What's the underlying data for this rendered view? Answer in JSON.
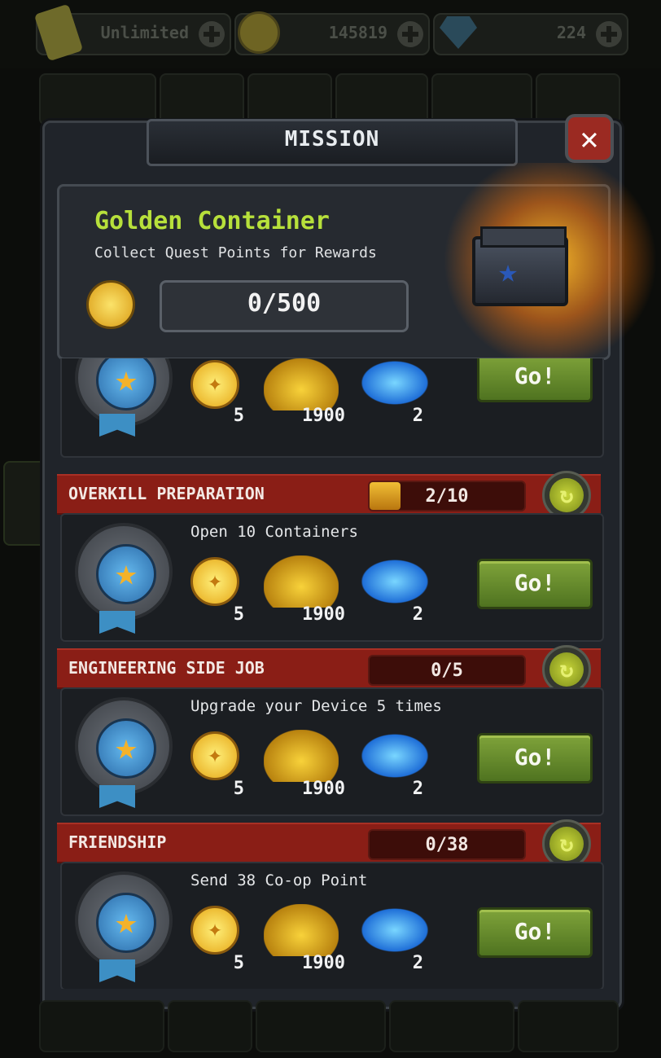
{
  "currencies": {
    "energy": {
      "value": "Unlimited",
      "icon": "dog-tag-icon"
    },
    "coins": {
      "value": "145819",
      "icon": "coin-icon"
    },
    "gems": {
      "value": "224",
      "icon": "gem-icon"
    }
  },
  "dialog": {
    "title": "MISSION",
    "close_icon": "close-icon"
  },
  "golden_container": {
    "name": "Golden Container",
    "subtitle": "Collect Quest Points for Rewards",
    "progress": "0/500",
    "progress_current": 0,
    "progress_max": 500
  },
  "missions": [
    {
      "name": "",
      "description": "",
      "progress": "",
      "progress_fraction": 0,
      "rewards": {
        "quest_points": "5",
        "coins": "1900",
        "gems": "2"
      },
      "go_label": "Go!"
    },
    {
      "name": "OVERKILL PREPARATION",
      "description": "Open 10 Containers",
      "progress": "2/10",
      "progress_fraction": 0.2,
      "rewards": {
        "quest_points": "5",
        "coins": "1900",
        "gems": "2"
      },
      "go_label": "Go!"
    },
    {
      "name": "ENGINEERING SIDE JOB",
      "description": "Upgrade your Device 5 times",
      "progress": "0/5",
      "progress_fraction": 0,
      "rewards": {
        "quest_points": "5",
        "coins": "1900",
        "gems": "2"
      },
      "go_label": "Go!"
    },
    {
      "name": "FRIENDSHIP",
      "description": "Send 38 Co-op Point",
      "progress": "0/38",
      "progress_fraction": 0,
      "rewards": {
        "quest_points": "5",
        "coins": "1900",
        "gems": "2"
      },
      "go_label": "Go!"
    }
  ],
  "colors": {
    "accent_green": "#b7e03b",
    "header_red": "#8a1e16",
    "go_green": "#6a8f2e"
  }
}
